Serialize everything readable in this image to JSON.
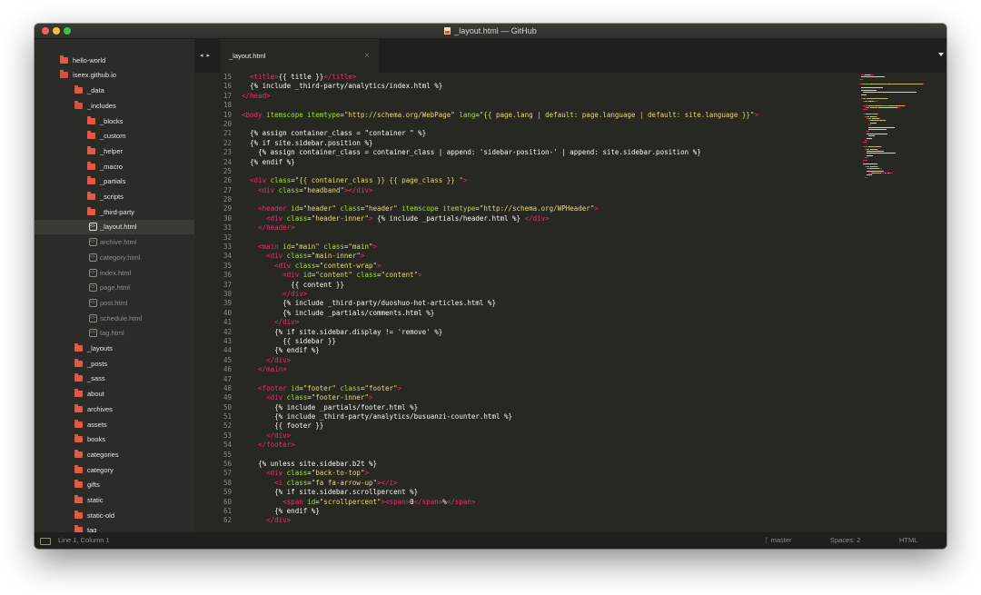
{
  "window": {
    "title": "_layout.html — GitHub"
  },
  "sidebar": {
    "items": [
      {
        "label": "hello-world",
        "type": "folder",
        "depth": 0
      },
      {
        "label": "iseex.github.io",
        "type": "folder-open",
        "depth": 0
      },
      {
        "label": "_data",
        "type": "folder",
        "depth": 1
      },
      {
        "label": "_includes",
        "type": "folder-open",
        "depth": 1
      },
      {
        "label": "_blocks",
        "type": "folder",
        "depth": 2
      },
      {
        "label": "_custom",
        "type": "folder",
        "depth": 2
      },
      {
        "label": "_helper",
        "type": "folder",
        "depth": 2
      },
      {
        "label": "_macro",
        "type": "folder",
        "depth": 2
      },
      {
        "label": "_partials",
        "type": "folder",
        "depth": 2
      },
      {
        "label": "_scripts",
        "type": "folder",
        "depth": 2
      },
      {
        "label": "_third-party",
        "type": "folder",
        "depth": 2
      },
      {
        "label": "_layout.html",
        "type": "file",
        "depth": 2,
        "selected": true
      },
      {
        "label": "archive.html",
        "type": "file",
        "depth": 2
      },
      {
        "label": "category.html",
        "type": "file",
        "depth": 2
      },
      {
        "label": "index.html",
        "type": "file",
        "depth": 2
      },
      {
        "label": "page.html",
        "type": "file",
        "depth": 2
      },
      {
        "label": "post.html",
        "type": "file",
        "depth": 2
      },
      {
        "label": "schedule.html",
        "type": "file",
        "depth": 2
      },
      {
        "label": "tag.html",
        "type": "file",
        "depth": 2
      },
      {
        "label": "_layouts",
        "type": "folder",
        "depth": 1
      },
      {
        "label": "_posts",
        "type": "folder",
        "depth": 1
      },
      {
        "label": "_sass",
        "type": "folder",
        "depth": 1
      },
      {
        "label": "about",
        "type": "folder",
        "depth": 1
      },
      {
        "label": "archives",
        "type": "folder",
        "depth": 1
      },
      {
        "label": "assets",
        "type": "folder",
        "depth": 1
      },
      {
        "label": "books",
        "type": "folder",
        "depth": 1
      },
      {
        "label": "categories",
        "type": "folder",
        "depth": 1
      },
      {
        "label": "category",
        "type": "folder",
        "depth": 1
      },
      {
        "label": "gifts",
        "type": "folder",
        "depth": 1
      },
      {
        "label": "static",
        "type": "folder",
        "depth": 1
      },
      {
        "label": "static-old",
        "type": "folder",
        "depth": 1
      },
      {
        "label": "tag",
        "type": "folder",
        "depth": 1
      }
    ]
  },
  "tabs": [
    {
      "label": "_layout.html",
      "close": "×"
    }
  ],
  "nav_arrows": "◂ ▸",
  "editor": {
    "lines": [
      {
        "n": "15",
        "i": 1,
        "segs": [
          [
            "t",
            "<title>"
          ],
          [
            "p",
            "{{ title }}"
          ],
          [
            "t",
            "</title>"
          ]
        ]
      },
      {
        "n": "16",
        "i": 1,
        "segs": [
          [
            "p",
            "{% include _third-party/analytics/index.html %}"
          ]
        ]
      },
      {
        "n": "17",
        "i": 0,
        "segs": [
          [
            "t",
            "</head>"
          ]
        ]
      },
      {
        "n": "18",
        "i": 0,
        "segs": []
      },
      {
        "n": "19",
        "i": 0,
        "segs": [
          [
            "t",
            "<body"
          ],
          [
            "a",
            " itemscope itemtype"
          ],
          [
            "p",
            "="
          ],
          [
            "s",
            "\"http://schema.org/WebPage\""
          ],
          [
            "a",
            " lang"
          ],
          [
            "p",
            "="
          ],
          [
            "s",
            "\"{{ page.lang | default: page.language | default: site.language }}\""
          ],
          [
            "t",
            ">"
          ]
        ]
      },
      {
        "n": "20",
        "i": 0,
        "segs": []
      },
      {
        "n": "21",
        "i": 1,
        "segs": [
          [
            "p",
            "{% assign container_class = \"container \" %}"
          ]
        ]
      },
      {
        "n": "22",
        "i": 1,
        "segs": [
          [
            "p",
            "{% if site.sidebar.position %}"
          ]
        ]
      },
      {
        "n": "23",
        "i": 2,
        "segs": [
          [
            "p",
            "{% assign container_class = container_class | append: 'sidebar-position-' | append: site.sidebar.position %}"
          ]
        ]
      },
      {
        "n": "24",
        "i": 1,
        "segs": [
          [
            "p",
            "{% endif %}"
          ]
        ]
      },
      {
        "n": "25",
        "i": 0,
        "segs": []
      },
      {
        "n": "26",
        "i": 1,
        "segs": [
          [
            "t",
            "<div"
          ],
          [
            "a",
            " class"
          ],
          [
            "p",
            "="
          ],
          [
            "s",
            "\"{{ container_class }} {{ page_class }} \""
          ],
          [
            "t",
            ">"
          ]
        ]
      },
      {
        "n": "27",
        "i": 2,
        "segs": [
          [
            "t",
            "<div"
          ],
          [
            "a",
            " class"
          ],
          [
            "p",
            "="
          ],
          [
            "s",
            "\"headband\""
          ],
          [
            "t",
            "></div>"
          ]
        ]
      },
      {
        "n": "28",
        "i": 0,
        "segs": []
      },
      {
        "n": "29",
        "i": 2,
        "segs": [
          [
            "t",
            "<header"
          ],
          [
            "a",
            " id"
          ],
          [
            "p",
            "="
          ],
          [
            "s",
            "\"header\""
          ],
          [
            "a",
            " class"
          ],
          [
            "p",
            "="
          ],
          [
            "s",
            "\"header\""
          ],
          [
            "a",
            " itemscope itemtype"
          ],
          [
            "p",
            "="
          ],
          [
            "s",
            "\"http://schema.org/WPHeader\""
          ],
          [
            "t",
            ">"
          ]
        ]
      },
      {
        "n": "30",
        "i": 3,
        "segs": [
          [
            "t",
            "<div"
          ],
          [
            "a",
            " class"
          ],
          [
            "p",
            "="
          ],
          [
            "s",
            "\"header-inner\""
          ],
          [
            "t",
            ">"
          ],
          [
            "p",
            " {% include _partials/header.html %} "
          ],
          [
            "t",
            "</div>"
          ]
        ]
      },
      {
        "n": "31",
        "i": 2,
        "segs": [
          [
            "t",
            "</header>"
          ]
        ]
      },
      {
        "n": "32",
        "i": 0,
        "segs": []
      },
      {
        "n": "33",
        "i": 2,
        "segs": [
          [
            "t",
            "<main"
          ],
          [
            "a",
            " id"
          ],
          [
            "p",
            "="
          ],
          [
            "s",
            "\"main\""
          ],
          [
            "a",
            " class"
          ],
          [
            "p",
            "="
          ],
          [
            "s",
            "\"main\""
          ],
          [
            "t",
            ">"
          ]
        ]
      },
      {
        "n": "34",
        "i": 3,
        "segs": [
          [
            "t",
            "<div"
          ],
          [
            "a",
            " class"
          ],
          [
            "p",
            "="
          ],
          [
            "s",
            "\"main-inner\""
          ],
          [
            "t",
            ">"
          ]
        ]
      },
      {
        "n": "35",
        "i": 4,
        "segs": [
          [
            "t",
            "<div"
          ],
          [
            "a",
            " class"
          ],
          [
            "p",
            "="
          ],
          [
            "s",
            "\"content-wrap\""
          ],
          [
            "t",
            ">"
          ]
        ]
      },
      {
        "n": "36",
        "i": 5,
        "segs": [
          [
            "t",
            "<div"
          ],
          [
            "a",
            " id"
          ],
          [
            "p",
            "="
          ],
          [
            "s",
            "\"content\""
          ],
          [
            "a",
            " class"
          ],
          [
            "p",
            "="
          ],
          [
            "s",
            "\"content\""
          ],
          [
            "t",
            ">"
          ]
        ]
      },
      {
        "n": "37",
        "i": 6,
        "segs": [
          [
            "p",
            "{{ content }}"
          ]
        ]
      },
      {
        "n": "38",
        "i": 5,
        "segs": [
          [
            "t",
            "</div>"
          ]
        ]
      },
      {
        "n": "39",
        "i": 5,
        "segs": [
          [
            "p",
            "{% include _third-party/duoshuo-hot-articles.html %}"
          ]
        ]
      },
      {
        "n": "40",
        "i": 5,
        "segs": [
          [
            "p",
            "{% include _partials/comments.html %}"
          ]
        ]
      },
      {
        "n": "41",
        "i": 4,
        "segs": [
          [
            "t",
            "</div>"
          ]
        ]
      },
      {
        "n": "42",
        "i": 4,
        "segs": [
          [
            "p",
            "{% if site.sidebar.display != 'remove' %}"
          ]
        ]
      },
      {
        "n": "43",
        "i": 5,
        "segs": [
          [
            "p",
            "{{ sidebar }}"
          ]
        ]
      },
      {
        "n": "44",
        "i": 4,
        "segs": [
          [
            "p",
            "{% endif %}"
          ]
        ]
      },
      {
        "n": "45",
        "i": 3,
        "segs": [
          [
            "t",
            "</div>"
          ]
        ]
      },
      {
        "n": "46",
        "i": 2,
        "segs": [
          [
            "t",
            "</main>"
          ]
        ]
      },
      {
        "n": "47",
        "i": 0,
        "segs": []
      },
      {
        "n": "48",
        "i": 2,
        "segs": [
          [
            "t",
            "<footer"
          ],
          [
            "a",
            " id"
          ],
          [
            "p",
            "="
          ],
          [
            "s",
            "\"footer\""
          ],
          [
            "a",
            " class"
          ],
          [
            "p",
            "="
          ],
          [
            "s",
            "\"footer\""
          ],
          [
            "t",
            ">"
          ]
        ]
      },
      {
        "n": "49",
        "i": 3,
        "segs": [
          [
            "t",
            "<div"
          ],
          [
            "a",
            " class"
          ],
          [
            "p",
            "="
          ],
          [
            "s",
            "\"footer-inner\""
          ],
          [
            "t",
            ">"
          ]
        ]
      },
      {
        "n": "50",
        "i": 4,
        "segs": [
          [
            "p",
            "{% include _partials/footer.html %}"
          ]
        ]
      },
      {
        "n": "51",
        "i": 4,
        "segs": [
          [
            "p",
            "{% include _third-party/analytics/busuanzi-counter.html %}"
          ]
        ]
      },
      {
        "n": "52",
        "i": 4,
        "segs": [
          [
            "p",
            "{{ footer }}"
          ]
        ]
      },
      {
        "n": "53",
        "i": 3,
        "segs": [
          [
            "t",
            "</div>"
          ]
        ]
      },
      {
        "n": "54",
        "i": 2,
        "segs": [
          [
            "t",
            "</footer>"
          ]
        ]
      },
      {
        "n": "55",
        "i": 0,
        "segs": []
      },
      {
        "n": "56",
        "i": 2,
        "segs": [
          [
            "p",
            "{% unless site.sidebar.b2t %}"
          ]
        ]
      },
      {
        "n": "57",
        "i": 3,
        "segs": [
          [
            "t",
            "<div"
          ],
          [
            "a",
            " class"
          ],
          [
            "p",
            "="
          ],
          [
            "s",
            "\"back-to-top\""
          ],
          [
            "t",
            ">"
          ]
        ]
      },
      {
        "n": "58",
        "i": 4,
        "segs": [
          [
            "t",
            "<i"
          ],
          [
            "a",
            " class"
          ],
          [
            "p",
            "="
          ],
          [
            "s",
            "\"fa fa-arrow-up\""
          ],
          [
            "t",
            "></i>"
          ]
        ]
      },
      {
        "n": "59",
        "i": 4,
        "segs": [
          [
            "p",
            "{% if site.sidebar.scrollpercent %}"
          ]
        ]
      },
      {
        "n": "60",
        "i": 5,
        "segs": [
          [
            "t",
            "<span"
          ],
          [
            "a",
            " id"
          ],
          [
            "p",
            "="
          ],
          [
            "s",
            "\"scrollpercent\""
          ],
          [
            "t",
            "><span>"
          ],
          [
            "p",
            "0"
          ],
          [
            "t",
            "</span>"
          ],
          [
            "p",
            "%"
          ],
          [
            "t",
            "</span>"
          ]
        ]
      },
      {
        "n": "61",
        "i": 4,
        "segs": [
          [
            "p",
            "{% endif %}"
          ]
        ]
      },
      {
        "n": "62",
        "i": 3,
        "segs": [
          [
            "t",
            "</div>"
          ]
        ]
      }
    ]
  },
  "status": {
    "position": "Line 1, Column 1",
    "branch": "master",
    "spaces": "Spaces: 2",
    "syntax": "HTML",
    "branch_icon": "ᚴ"
  },
  "colors": {
    "tag": "#f92672",
    "attr": "#a6e22e",
    "string": "#e6db74",
    "text": "#f8f8f2",
    "folder": "#e05a48",
    "background": "#272822"
  }
}
